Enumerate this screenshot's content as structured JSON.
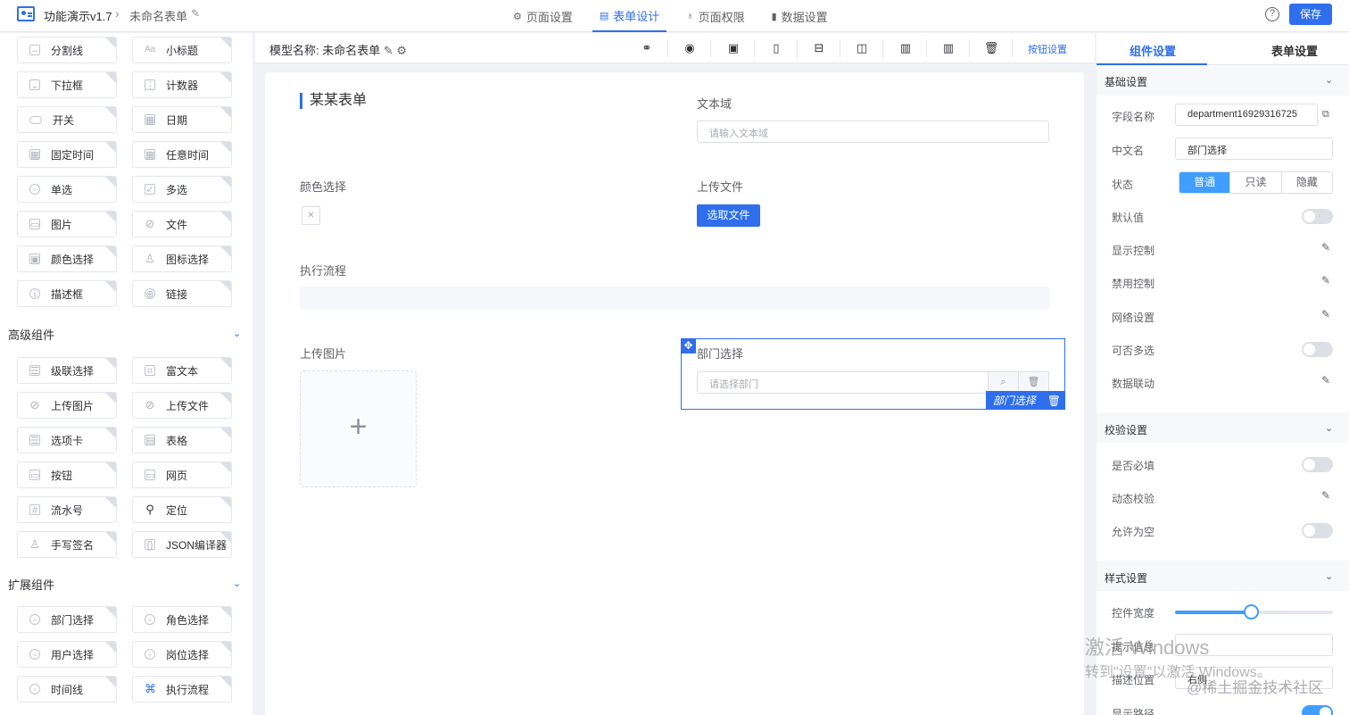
{
  "header": {
    "app_title": "功能演示v1.7",
    "form_name": "未命名表单",
    "tabs": [
      {
        "label": "页面设置",
        "icon": "gear-icon"
      },
      {
        "label": "表单设计",
        "icon": "document-icon"
      },
      {
        "label": "页面权限",
        "icon": "lock-icon"
      },
      {
        "label": "数据设置",
        "icon": "bar-chart-icon"
      }
    ],
    "active_tab": "表单设计",
    "save_label": "保存",
    "help_glyph": "?"
  },
  "left": {
    "basic": [
      {
        "label": "分割线",
        "icon": "divider-icon"
      },
      {
        "label": "小标题",
        "icon": "subtitle-icon"
      },
      {
        "label": "下拉框",
        "icon": "dropdown-icon"
      },
      {
        "label": "计数器",
        "icon": "counter-icon"
      },
      {
        "label": "开关",
        "icon": "switch-icon"
      },
      {
        "label": "日期",
        "icon": "calendar-icon"
      },
      {
        "label": "固定时间",
        "icon": "calendar-icon"
      },
      {
        "label": "任意时间",
        "icon": "calendar-icon"
      },
      {
        "label": "单选",
        "icon": "radio-icon"
      },
      {
        "label": "多选",
        "icon": "checkbox-icon"
      },
      {
        "label": "图片",
        "icon": "image-icon"
      },
      {
        "label": "文件",
        "icon": "paperclip-icon"
      },
      {
        "label": "颜色选择",
        "icon": "color-icon"
      },
      {
        "label": "图标选择",
        "icon": "user-icon"
      },
      {
        "label": "描述框",
        "icon": "info-icon"
      },
      {
        "label": "链接",
        "icon": "globe-icon"
      }
    ],
    "advanced_title": "高级组件",
    "advanced": [
      {
        "label": "级联选择",
        "icon": "cascade-icon"
      },
      {
        "label": "富文本",
        "icon": "richtext-icon"
      },
      {
        "label": "上传图片",
        "icon": "paperclip-icon"
      },
      {
        "label": "上传文件",
        "icon": "paperclip-icon"
      },
      {
        "label": "选项卡",
        "icon": "tabs-icon"
      },
      {
        "label": "表格",
        "icon": "table-icon"
      },
      {
        "label": "按钮",
        "icon": "button-icon"
      },
      {
        "label": "网页",
        "icon": "webpage-icon"
      },
      {
        "label": "流水号",
        "icon": "serial-icon"
      },
      {
        "label": "定位",
        "icon": "location-pin-icon"
      },
      {
        "label": "手写签名",
        "icon": "user-icon"
      },
      {
        "label": "JSON编译器",
        "icon": "code-icon"
      }
    ],
    "extended_title": "扩展组件",
    "extended": [
      {
        "label": "部门选择",
        "icon": "radio-icon"
      },
      {
        "label": "角色选择",
        "icon": "radio-icon"
      },
      {
        "label": "用户选择",
        "icon": "radio-icon"
      },
      {
        "label": "岗位选择",
        "icon": "radio-icon"
      },
      {
        "label": "时间线",
        "icon": "radio-icon"
      },
      {
        "label": "执行流程",
        "icon": "flow-icon"
      }
    ]
  },
  "canvas": {
    "model_label": "模型名称:",
    "model_name": "未命名表单",
    "button_settings": "按钮设置",
    "form_title": "某某表单",
    "textarea_label": "文本域",
    "textarea_placeholder": "请输入文本域",
    "color_label": "颜色选择",
    "upload_file_label": "上传文件",
    "select_file_button": "选取文件",
    "flow_label": "执行流程",
    "upload_image_label": "上传图片",
    "upload_plus": "+",
    "dept_label": "部门选择",
    "dept_placeholder": "请选择部门",
    "dept_tag": "部门选择"
  },
  "right": {
    "tab_component": "组件设置",
    "tab_form": "表单设置",
    "basic_title": "基础设置",
    "field_name_label": "字段名称",
    "field_name_value": "department16929316725",
    "cn_name_label": "中文名",
    "cn_name_value": "部门选择",
    "status_label": "状态",
    "status_options": [
      "普通",
      "只读",
      "隐藏"
    ],
    "status_selected": "普通",
    "default_label": "默认值",
    "display_control": "显示控制",
    "disable_control": "禁用控制",
    "network_settings": "网络设置",
    "multi_select": "可否多选",
    "data_link": "数据联动",
    "validation_title": "校验设置",
    "required_label": "是否必填",
    "dynamic_validation": "动态校验",
    "allow_empty": "允许为空",
    "style_title": "样式设置",
    "width_label": "控件宽度",
    "width_value": 0.48,
    "hint_label": "提示信息",
    "desc_pos_label": "描述位置",
    "desc_pos_value": "右侧",
    "show_path_label": "显示路径"
  },
  "watermark": {
    "line1": "激活 Windows",
    "line2": "转到\"设置\"以激活 Windows。",
    "line3": "@稀土掘金技术社区"
  },
  "colors": {
    "accent": "#2f6fed",
    "toggle_on": "#409eff"
  }
}
